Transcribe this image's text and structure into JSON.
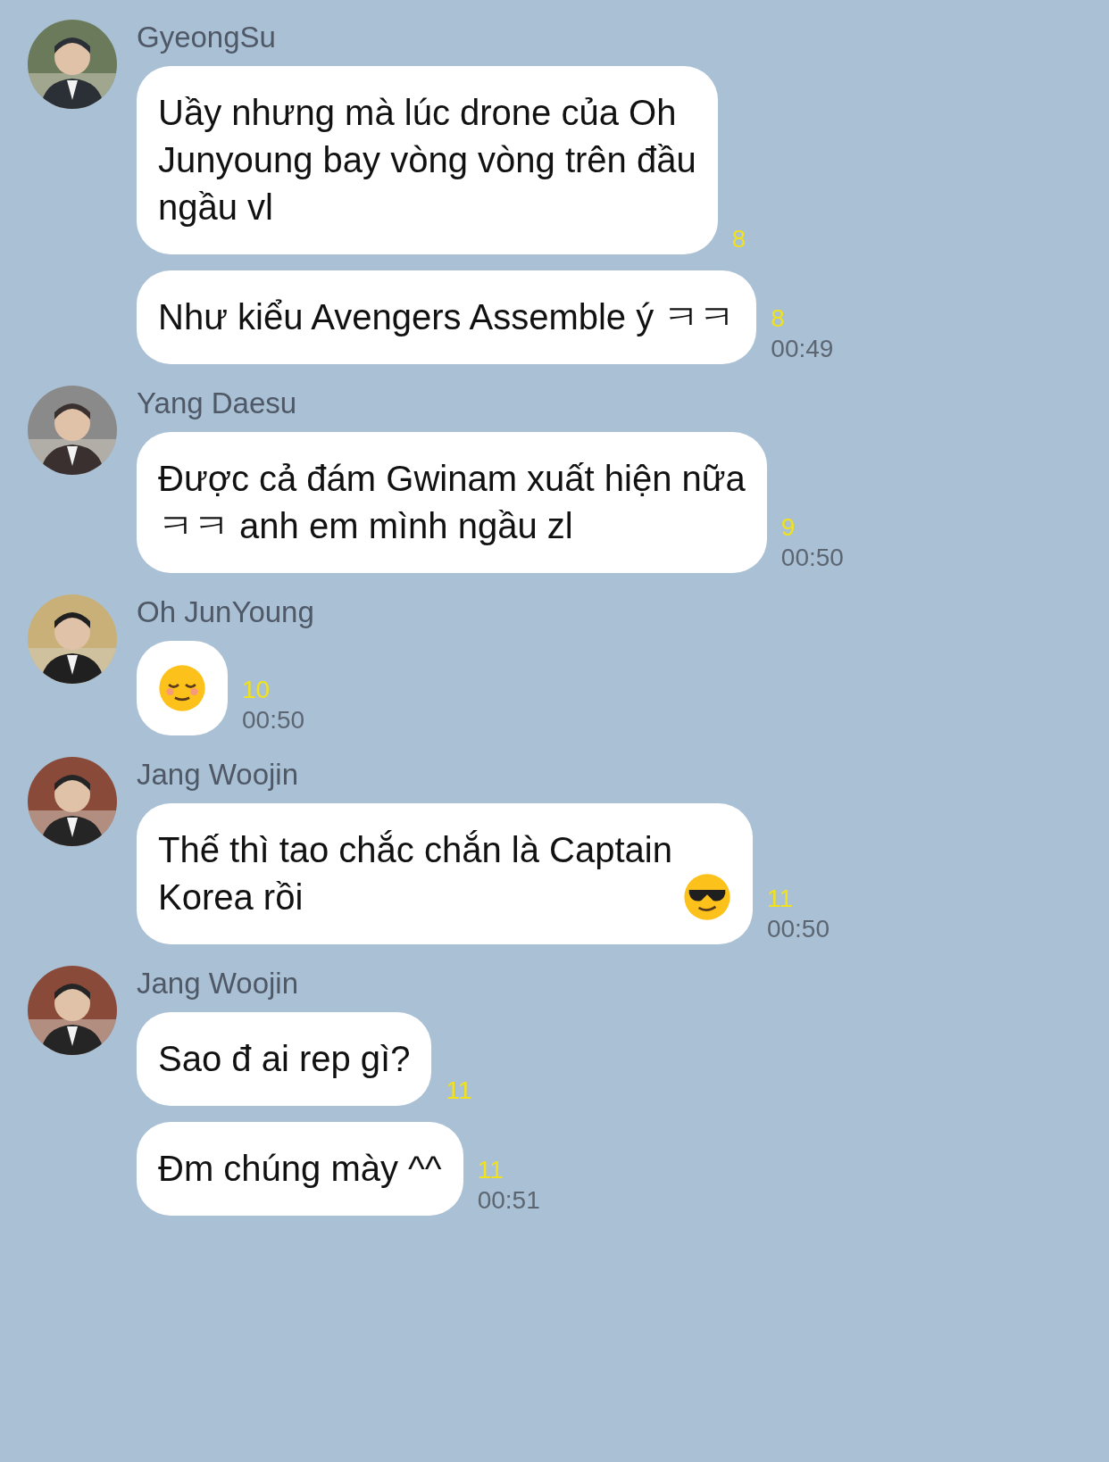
{
  "messages": [
    {
      "sender": "GyeongSu",
      "bubbles": [
        {
          "parts": [
            {
              "kind": "text",
              "text": "Uầy nhưng mà lúc drone của Oh\nJunyoung bay vòng vòng trên đầu\nngầu vl"
            }
          ],
          "read": "8"
        },
        {
          "parts": [
            {
              "kind": "text",
              "text": "Như kiểu Avengers Assemble ý ㅋㅋ"
            }
          ],
          "read": "8",
          "time": "00:49"
        }
      ]
    },
    {
      "sender": "Yang Daesu",
      "bubbles": [
        {
          "parts": [
            {
              "kind": "text",
              "text": "Được cả đám Gwinam xuất hiện nữa\nㅋㅋ anh em mình ngầu zl"
            }
          ],
          "read": "9",
          "time": "00:50"
        }
      ]
    },
    {
      "sender": "Oh JunYoung",
      "bubbles": [
        {
          "parts": [
            {
              "kind": "relieved"
            }
          ],
          "read": "10",
          "time": "00:50"
        }
      ]
    },
    {
      "sender": "Jang Woojin",
      "bubbles": [
        {
          "parts": [
            {
              "kind": "text",
              "text": "Thế thì tao chắc chắn là Captain\nKorea rồi"
            },
            {
              "kind": "cool"
            }
          ],
          "read": "11",
          "time": "00:50"
        }
      ]
    },
    {
      "sender": "Jang Woojin",
      "bubbles": [
        {
          "parts": [
            {
              "kind": "text",
              "text": "Sao đ ai rep gì?"
            }
          ],
          "read": "11"
        },
        {
          "parts": [
            {
              "kind": "text",
              "text": "Đm chúng mày ^^"
            }
          ],
          "read": "11",
          "time": "00:51"
        }
      ]
    }
  ]
}
